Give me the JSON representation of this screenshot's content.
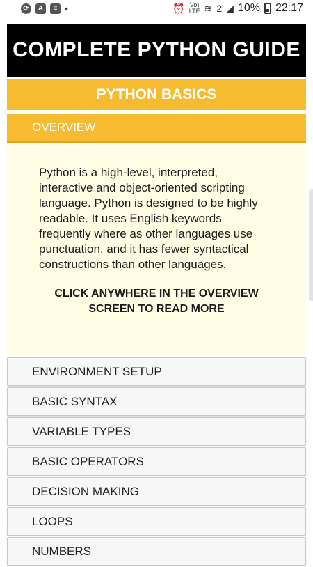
{
  "status_bar": {
    "battery": "10%",
    "time": "22:17",
    "lte_label": "LTE",
    "sim_slot": "2"
  },
  "title": "COMPLETE PYTHON GUIDE",
  "section": "PYTHON BASICS",
  "overview": {
    "tab_label": "OVERVIEW",
    "text": "Python is a high-level, interpreted, interactive and object-oriented scripting language. Python is designed to be highly readable. It uses English keywords frequently where as other languages use punctuation, and it has fewer syntactical constructions than other languages.",
    "cta": "CLICK ANYWHERE IN THE OVERVIEW SCREEN TO READ MORE"
  },
  "menu": [
    "ENVIRONMENT SETUP",
    "BASIC SYNTAX",
    "VARIABLE TYPES",
    "BASIC OPERATORS",
    "DECISION MAKING",
    "LOOPS",
    "NUMBERS"
  ],
  "colors": {
    "accent": "#f6bb30",
    "title_bg": "#000000",
    "panel_bg": "#fffde4"
  }
}
